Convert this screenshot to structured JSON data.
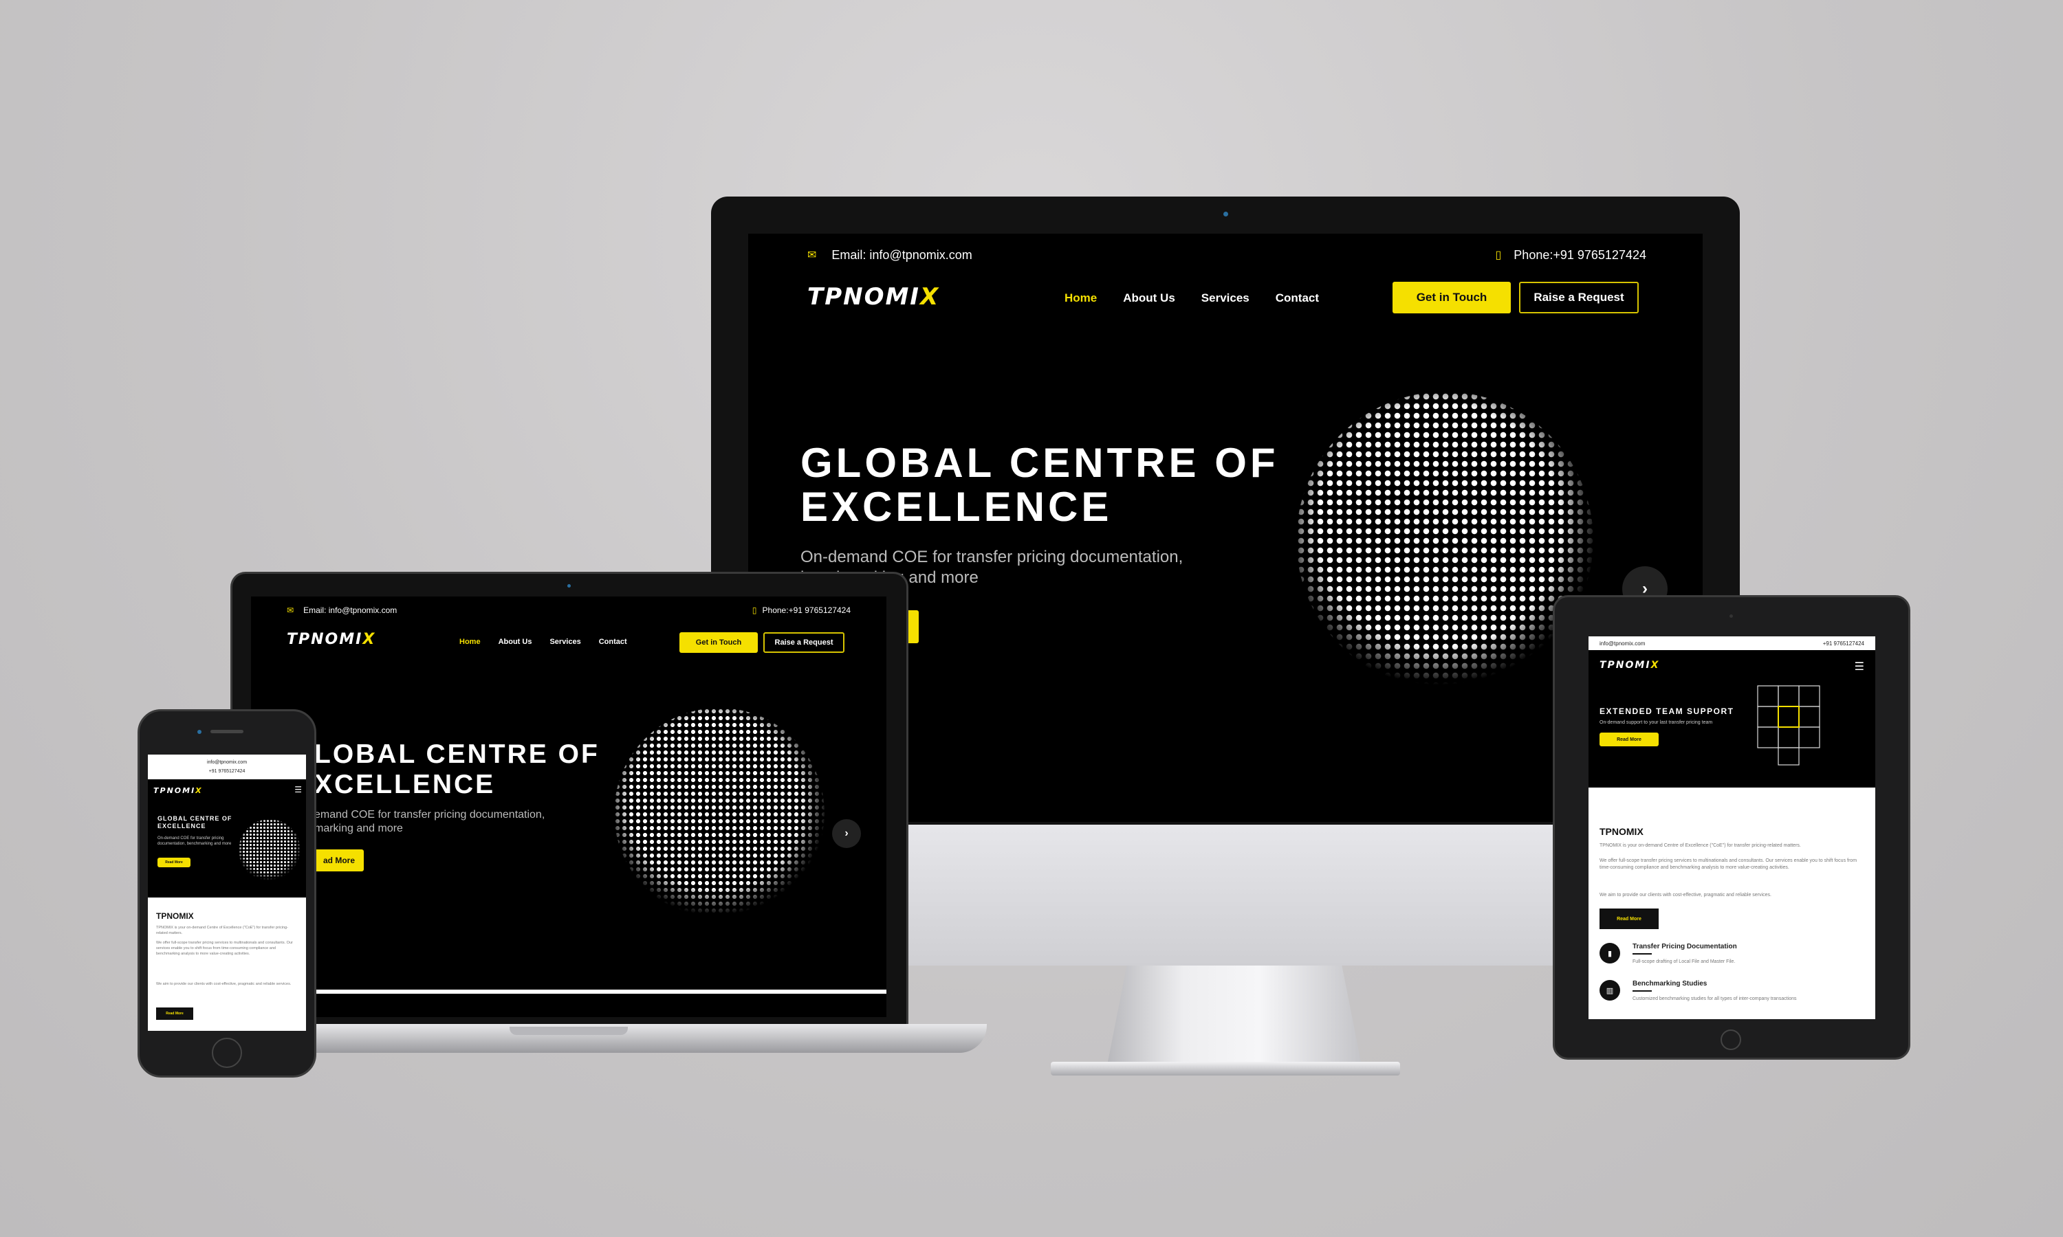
{
  "contact": {
    "email": "Email: info@tpnomix.com",
    "phone": "Phone:+91 9765127424",
    "email_short": "info@tpnomix.com",
    "phone_short": "+91 9765127424"
  },
  "logo": {
    "text": "TPNOMI",
    "accent": "X"
  },
  "nav": {
    "home": "Home",
    "about": "About Us",
    "services": "Services",
    "contact": "Contact"
  },
  "buttons": {
    "get_in_touch": "Get in Touch",
    "raise_request": "Raise a Request",
    "read_more": "Read More"
  },
  "hero": {
    "title_line1": "GLOBAL CENTRE OF",
    "title_line2": "EXCELLENCE",
    "subtitle_line1": "On-demand COE for transfer pricing documentation,",
    "subtitle_line2": "benchmarking and more",
    "laptop_title_line1": "LOBAL CENTRE OF",
    "laptop_title_line2": "XCELLENCE",
    "laptop_sub_line1": "emand COE for transfer pricing documentation,",
    "laptop_sub_line2": "marking and more",
    "laptop_btn": "ad More",
    "desktop_sub_line2_partial": "and more",
    "phone_title": "GLOBAL CENTRE OF EXCELLENCE",
    "phone_sub": "On-demand COE for transfer pricing documentation, benchmarking and more"
  },
  "tablet_hero": {
    "title": "EXTENDED TEAM SUPPORT",
    "subtitle": "On-demand support to your last transfer pricing team"
  },
  "about": {
    "heading": "TPNOMIX",
    "p1": "TPNOMIX is your on-demand Centre of Excellence (\"CoE\") for transfer pricing-related matters.",
    "p2": "We offer full-scope transfer pricing services to multinationals and consultants. Our services enable you to shift focus from time-consuming compliance and benchmarking analysis to more value-creating activities.",
    "p3": "We aim to provide our clients with cost-effective, pragmatic and reliable services."
  },
  "services": [
    {
      "title": "Transfer Pricing Documentation",
      "desc": "Full-scope drafting of Local File and Master File."
    },
    {
      "title": "Benchmarking Studies",
      "desc": "Customized benchmarking studies for all types of inter-company transactions"
    }
  ],
  "colors": {
    "accent": "#f5e000",
    "background": "#000000",
    "page_bg": "#c8c6c7"
  },
  "icons": {
    "email": "envelope-icon",
    "phone": "mobile-phone-icon",
    "next": "chevron-right-icon",
    "menu": "hamburger-menu-icon"
  }
}
